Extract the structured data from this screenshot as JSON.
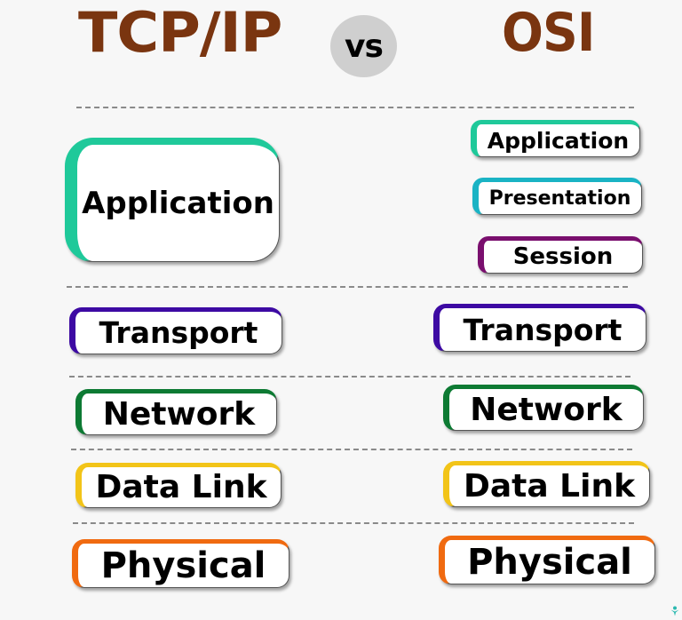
{
  "header": {
    "left_title": "TCP/IP",
    "vs_label": "vs",
    "right_title": "OSI",
    "title_color": "#7a3510"
  },
  "tcpip": {
    "layers": [
      {
        "label": "Application",
        "accent": "#1fc99a"
      },
      {
        "label": "Transport",
        "accent": "#3d0aa3"
      },
      {
        "label": "Network",
        "accent": "#0d7a33"
      },
      {
        "label": "Data Link",
        "accent": "#f2c418"
      },
      {
        "label": "Physical",
        "accent": "#f06a10"
      }
    ]
  },
  "osi": {
    "layers": [
      {
        "label": "Application",
        "accent": "#1fc99a"
      },
      {
        "label": "Presentation",
        "accent": "#1ab3c4"
      },
      {
        "label": "Session",
        "accent": "#7a0f6e"
      },
      {
        "label": "Transport",
        "accent": "#3d0aa3"
      },
      {
        "label": "Network",
        "accent": "#0d7a33"
      },
      {
        "label": "Data Link",
        "accent": "#f2c418"
      },
      {
        "label": "Physical",
        "accent": "#f06a10"
      }
    ]
  }
}
